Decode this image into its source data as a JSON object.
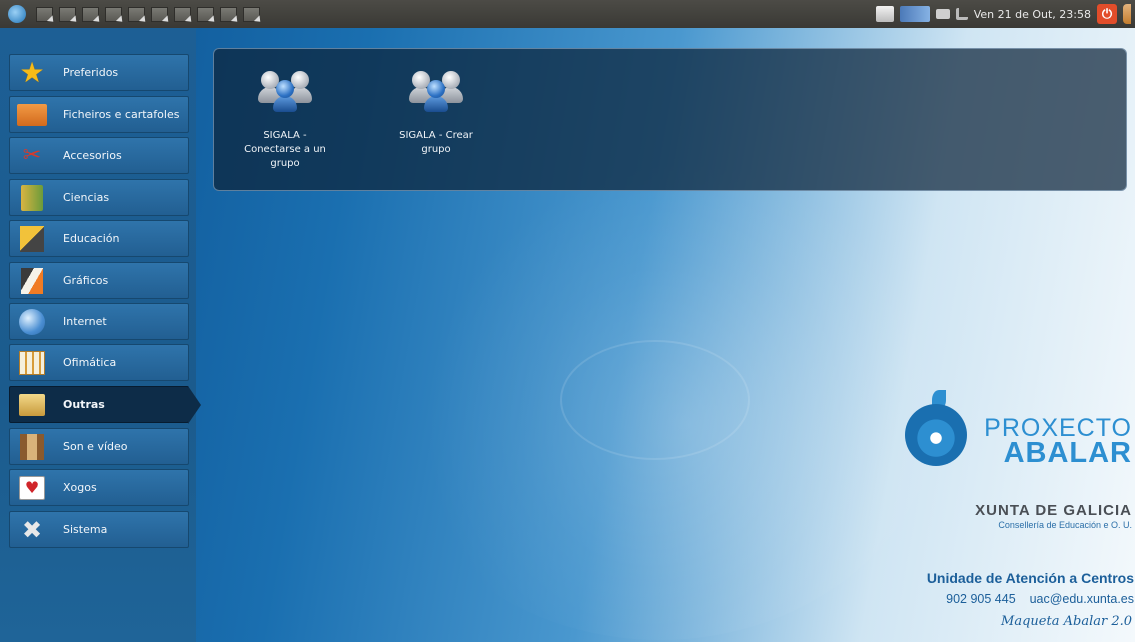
{
  "top_panel": {
    "clock": "Ven 21 de Out, 23:58",
    "launcher_count": 10,
    "icons": [
      "menu-logo-icon",
      "app-launcher-icon",
      "keyboard-icon",
      "network-icon",
      "battery-icon",
      "volume-icon",
      "power-icon",
      "user-icon"
    ]
  },
  "sidebar": {
    "categories": [
      {
        "label": "Preferidos",
        "icon": "star-icon"
      },
      {
        "label": "Ficheiros e cartafoles",
        "icon": "folder-icon"
      },
      {
        "label": "Accesorios",
        "icon": "tools-icon"
      },
      {
        "label": "Ciencias",
        "icon": "science-icon"
      },
      {
        "label": "Educación",
        "icon": "education-icon"
      },
      {
        "label": "Gráficos",
        "icon": "graphics-icon"
      },
      {
        "label": "Internet",
        "icon": "globe-icon"
      },
      {
        "label": "Ofimática",
        "icon": "office-icon"
      },
      {
        "label": "Outras",
        "icon": "box-icon"
      },
      {
        "label": "Son e vídeo",
        "icon": "media-icon"
      },
      {
        "label": "Xogos",
        "icon": "cards-icon"
      },
      {
        "label": "Sistema",
        "icon": "wrench-icon"
      }
    ],
    "active": "Outras"
  },
  "apps": [
    {
      "label": "SIGALA - Conectarse a un grupo",
      "icon": "group-users-icon"
    },
    {
      "label": "SIGALA - Crear grupo",
      "icon": "group-users-icon"
    }
  ],
  "branding": {
    "proxecto": "PROXECTO",
    "abalar": "ABALAR",
    "xunta": "XUNTA DE GALICIA",
    "consellaria": "Consellería de Educación e O. U.",
    "uac_title": "Unidade de Atención a Centros",
    "phone": "902 905 445",
    "email": "uac@edu.xunta.es",
    "maqueta": "Maqueta Abalar 2.0"
  },
  "colors": {
    "accent": "#2d8fd1",
    "sidebar": "#1d5f95",
    "active_item": "#0d2c48",
    "power": "#e24d2a"
  }
}
